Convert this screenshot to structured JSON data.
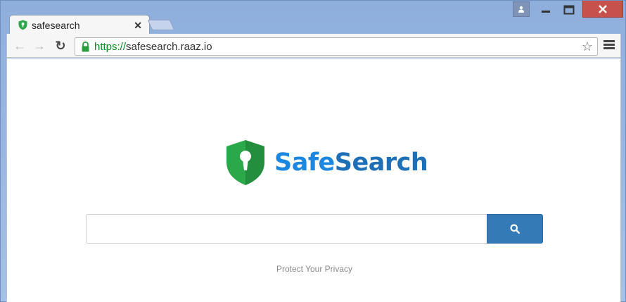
{
  "browser": {
    "tab": {
      "title": "safesearch",
      "close_glyph": "✕"
    },
    "address": {
      "scheme": "https://",
      "host": "safesearch.raaz.io"
    },
    "nav": {
      "back_glyph": "←",
      "forward_glyph": "→",
      "reload_glyph": "↻"
    },
    "star_glyph": "☆",
    "window_controls": {
      "minimize_glyph": "—",
      "close_glyph": "✕"
    }
  },
  "page": {
    "logo": {
      "text_part1": "Safe",
      "text_part2": "Search"
    },
    "search": {
      "placeholder": ""
    },
    "tagline": "Protect Your Privacy"
  },
  "colors": {
    "brand_blue": "#1b87e0",
    "brand_dark_blue": "#1d6fb8",
    "shield_green": "#2aa84a",
    "button_blue": "#337ab7",
    "close_red": "#c7514b"
  }
}
